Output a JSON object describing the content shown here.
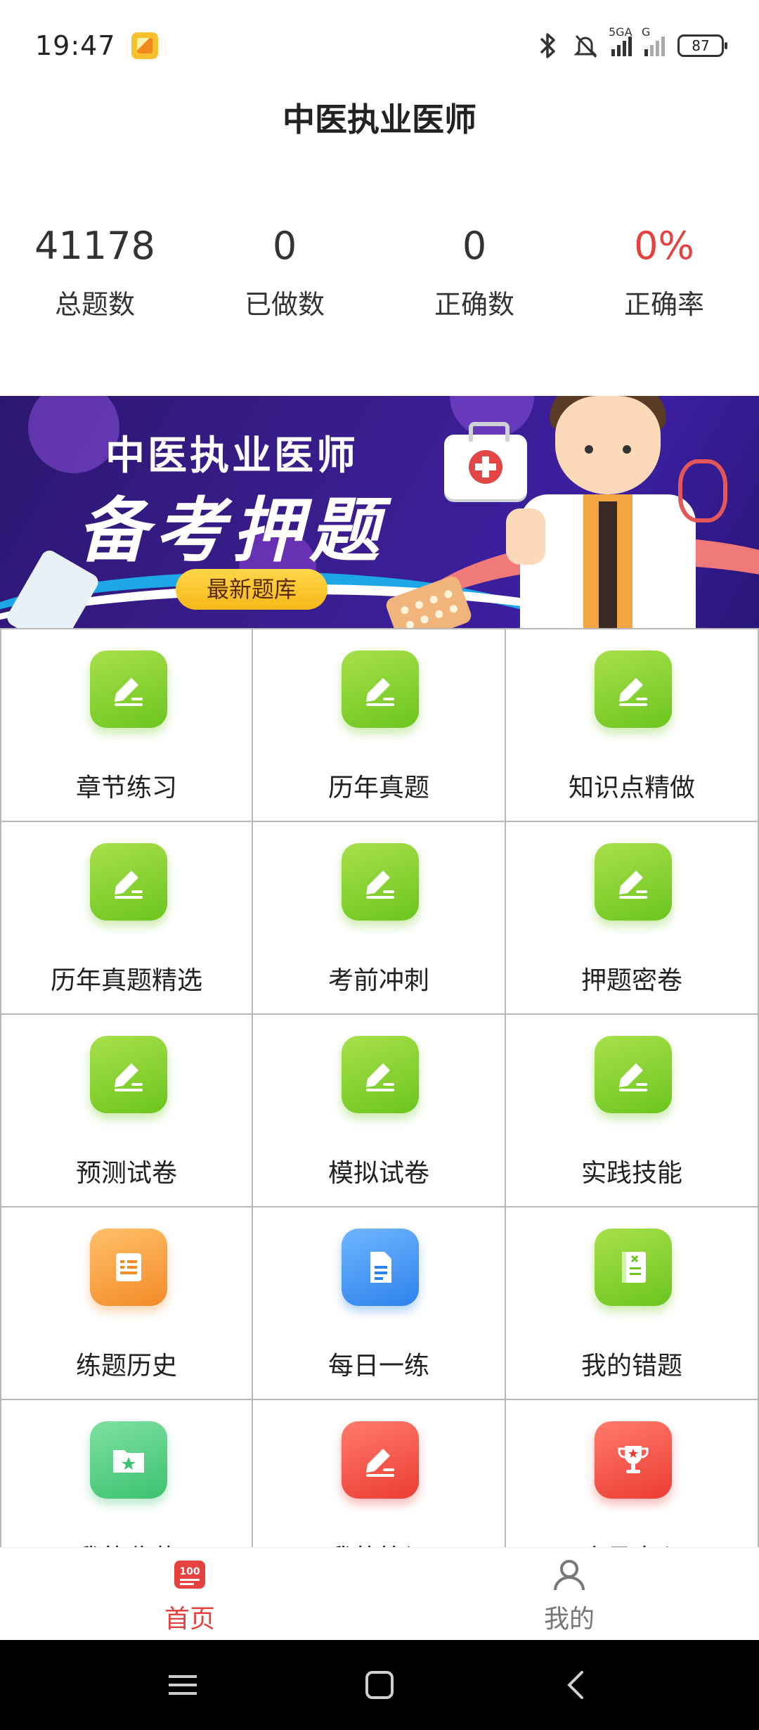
{
  "status_bar": {
    "time": "19:47",
    "network_label": "5GA",
    "network_label2": "G",
    "battery": "87"
  },
  "header": {
    "title": "中医执业医师"
  },
  "stats": [
    {
      "value": "41178",
      "label": "总题数"
    },
    {
      "value": "0",
      "label": "已做数"
    },
    {
      "value": "0",
      "label": "正确数"
    },
    {
      "value": "0%",
      "label": "正确率"
    }
  ],
  "banner": {
    "title": "中医执业医师",
    "subtitle": "备考押题",
    "badge": "最新题库"
  },
  "grid": {
    "items": [
      {
        "label": "章节练习",
        "icon": "pencil-edit-icon",
        "color": "green"
      },
      {
        "label": "历年真题",
        "icon": "pencil-edit-icon",
        "color": "green"
      },
      {
        "label": "知识点精做",
        "icon": "pencil-edit-icon",
        "color": "green"
      },
      {
        "label": "历年真题精选",
        "icon": "pencil-edit-icon",
        "color": "green"
      },
      {
        "label": "考前冲刺",
        "icon": "pencil-edit-icon",
        "color": "green"
      },
      {
        "label": "押题密卷",
        "icon": "pencil-edit-icon",
        "color": "green"
      },
      {
        "label": "预测试卷",
        "icon": "pencil-edit-icon",
        "color": "green"
      },
      {
        "label": "模拟试卷",
        "icon": "pencil-edit-icon",
        "color": "green"
      },
      {
        "label": "实践技能",
        "icon": "pencil-edit-icon",
        "color": "green"
      },
      {
        "label": "练题历史",
        "icon": "history-list-icon",
        "color": "orange"
      },
      {
        "label": "每日一练",
        "icon": "document-icon",
        "color": "blue"
      },
      {
        "label": "我的错题",
        "icon": "wrong-book-icon",
        "color": "green"
      },
      {
        "label": "我的收藏",
        "icon": "star-folder-icon",
        "color": "mint"
      },
      {
        "label": "我的笔记",
        "icon": "pencil-edit-icon",
        "color": "red"
      },
      {
        "label": "会员中心",
        "icon": "trophy-icon",
        "color": "red"
      }
    ]
  },
  "tabbar": {
    "home_label": "首页",
    "home_badge": "100",
    "mine_label": "我的"
  },
  "colors": {
    "accent_red": "#e5413e",
    "green": "#6cc51e"
  }
}
